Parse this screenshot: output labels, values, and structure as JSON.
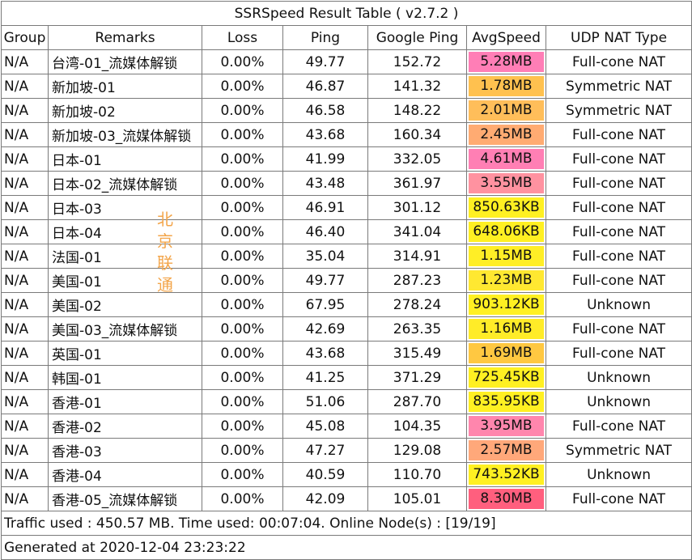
{
  "title": "SSRSpeed Result Table ( v2.7.2 )",
  "headers": [
    "Group",
    "Remarks",
    "Loss",
    "Ping",
    "Google Ping",
    "AvgSpeed",
    "UDP NAT Type"
  ],
  "rows": [
    {
      "group": "N/A",
      "remarks": "台湾-01_流媒体解锁",
      "loss": "0.00%",
      "ping": "49.77",
      "google_ping": "152.72",
      "avg_speed": "5.28MB",
      "speed_color": "#ff7eb6",
      "nat": "Full-cone NAT"
    },
    {
      "group": "N/A",
      "remarks": "新加坡-01",
      "loss": "0.00%",
      "ping": "46.87",
      "google_ping": "141.32",
      "avg_speed": "1.78MB",
      "speed_color": "#ffc14f",
      "nat": "Symmetric NAT"
    },
    {
      "group": "N/A",
      "remarks": "新加坡-02",
      "loss": "0.00%",
      "ping": "46.58",
      "google_ping": "148.22",
      "avg_speed": "2.01MB",
      "speed_color": "#ffbe5a",
      "nat": "Symmetric NAT"
    },
    {
      "group": "N/A",
      "remarks": "新加坡-03_流媒体解锁",
      "loss": "0.00%",
      "ping": "43.68",
      "google_ping": "160.34",
      "avg_speed": "2.45MB",
      "speed_color": "#ffab72",
      "nat": "Full-cone NAT"
    },
    {
      "group": "N/A",
      "remarks": "日本-01",
      "loss": "0.00%",
      "ping": "41.99",
      "google_ping": "332.05",
      "avg_speed": "4.61MB",
      "speed_color": "#ff7fb4",
      "nat": "Full-cone NAT"
    },
    {
      "group": "N/A",
      "remarks": "日本-02_流媒体解锁",
      "loss": "0.00%",
      "ping": "43.48",
      "google_ping": "361.97",
      "avg_speed": "3.55MB",
      "speed_color": "#ff92a0",
      "nat": "Full-cone NAT"
    },
    {
      "group": "N/A",
      "remarks": "日本-03",
      "loss": "0.00%",
      "ping": "46.91",
      "google_ping": "301.12",
      "avg_speed": "850.63KB",
      "speed_color": "#fff022",
      "nat": "Full-cone NAT"
    },
    {
      "group": "N/A",
      "remarks": "日本-04",
      "loss": "0.00%",
      "ping": "46.40",
      "google_ping": "341.04",
      "avg_speed": "648.06KB",
      "speed_color": "#fff022",
      "nat": "Full-cone NAT"
    },
    {
      "group": "N/A",
      "remarks": "法国-01",
      "loss": "0.00%",
      "ping": "35.04",
      "google_ping": "314.91",
      "avg_speed": "1.15MB",
      "speed_color": "#ffee26",
      "nat": "Full-cone NAT"
    },
    {
      "group": "N/A",
      "remarks": "美国-01",
      "loss": "0.00%",
      "ping": "49.77",
      "google_ping": "287.23",
      "avg_speed": "1.23MB",
      "speed_color": "#ffe831",
      "nat": "Full-cone NAT"
    },
    {
      "group": "N/A",
      "remarks": "美国-02",
      "loss": "0.00%",
      "ping": "67.95",
      "google_ping": "278.24",
      "avg_speed": "903.12KB",
      "speed_color": "#fff022",
      "nat": "Unknown"
    },
    {
      "group": "N/A",
      "remarks": "美国-03_流媒体解锁",
      "loss": "0.00%",
      "ping": "42.69",
      "google_ping": "263.35",
      "avg_speed": "1.16MB",
      "speed_color": "#ffec28",
      "nat": "Full-cone NAT"
    },
    {
      "group": "N/A",
      "remarks": "英国-01",
      "loss": "0.00%",
      "ping": "43.68",
      "google_ping": "315.49",
      "avg_speed": "1.69MB",
      "speed_color": "#ffc841",
      "nat": "Full-cone NAT"
    },
    {
      "group": "N/A",
      "remarks": "韩国-01",
      "loss": "0.00%",
      "ping": "41.25",
      "google_ping": "371.29",
      "avg_speed": "725.45KB",
      "speed_color": "#fff022",
      "nat": "Unknown"
    },
    {
      "group": "N/A",
      "remarks": "香港-01",
      "loss": "0.00%",
      "ping": "51.06",
      "google_ping": "287.70",
      "avg_speed": "835.95KB",
      "speed_color": "#fff022",
      "nat": "Unknown"
    },
    {
      "group": "N/A",
      "remarks": "香港-02",
      "loss": "0.00%",
      "ping": "45.08",
      "google_ping": "104.35",
      "avg_speed": "3.95MB",
      "speed_color": "#ff86ad",
      "nat": "Full-cone NAT"
    },
    {
      "group": "N/A",
      "remarks": "香港-03",
      "loss": "0.00%",
      "ping": "47.27",
      "google_ping": "129.08",
      "avg_speed": "2.57MB",
      "speed_color": "#ffa87a",
      "nat": "Symmetric NAT"
    },
    {
      "group": "N/A",
      "remarks": "香港-04",
      "loss": "0.00%",
      "ping": "40.59",
      "google_ping": "110.70",
      "avg_speed": "743.52KB",
      "speed_color": "#fff022",
      "nat": "Unknown"
    },
    {
      "group": "N/A",
      "remarks": "香港-05_流媒体解锁",
      "loss": "0.00%",
      "ping": "42.09",
      "google_ping": "105.01",
      "avg_speed": "8.30MB",
      "speed_color": "#ff5f7e",
      "nat": "Full-cone NAT"
    }
  ],
  "footer": {
    "traffic": "Traffic used : 450.57 MB. Time used: 00:07:04. Online Node(s) : [19/19]",
    "generated": "Generated at 2020-12-04 23:23:22"
  },
  "watermark": "北京联通",
  "watermark_color": "#f3a54a"
}
